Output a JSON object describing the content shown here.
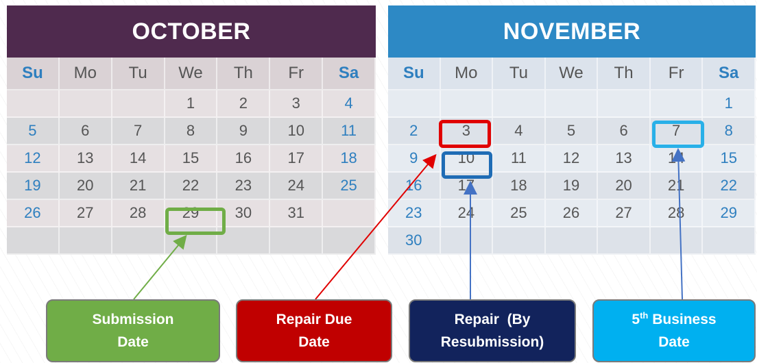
{
  "calendars": {
    "october": {
      "title": "OCTOBER",
      "days": [
        "Su",
        "Mo",
        "Tu",
        "We",
        "Th",
        "Fr",
        "Sa"
      ],
      "weeks": [
        [
          "",
          "",
          "",
          "1",
          "2",
          "3",
          "4"
        ],
        [
          "5",
          "6",
          "7",
          "8",
          "9",
          "10",
          "11"
        ],
        [
          "12",
          "13",
          "14",
          "15",
          "16",
          "17",
          "18"
        ],
        [
          "19",
          "20",
          "21",
          "22",
          "23",
          "24",
          "25"
        ],
        [
          "26",
          "27",
          "28",
          "29",
          "30",
          "31",
          ""
        ],
        [
          "",
          "",
          "",
          "",
          "",
          "",
          ""
        ]
      ]
    },
    "november": {
      "title": "NOVEMBER",
      "days": [
        "Su",
        "Mo",
        "Tu",
        "We",
        "Th",
        "Fr",
        "Sa"
      ],
      "weeks": [
        [
          "",
          "",
          "",
          "",
          "",
          "",
          "1"
        ],
        [
          "2",
          "3",
          "4",
          "5",
          "6",
          "7",
          "8"
        ],
        [
          "9",
          "10",
          "11",
          "12",
          "13",
          "14",
          "15"
        ],
        [
          "16",
          "17",
          "18",
          "19",
          "20",
          "21",
          "22"
        ],
        [
          "23",
          "24",
          "25",
          "26",
          "27",
          "28",
          "29"
        ],
        [
          "30",
          "",
          "",
          "",
          "",
          "",
          ""
        ]
      ]
    }
  },
  "callouts": {
    "submission": {
      "line1": "Submission",
      "line2": "Date",
      "color": "#70ad47"
    },
    "repair_due": {
      "line1": "Repair Due",
      "line2": "Date",
      "color": "#c00000"
    },
    "repair_resub": {
      "line1": "Repair  (By",
      "line2": "Resubmission)",
      "color": "#12235c"
    },
    "business": {
      "line1_num": "5",
      "line1_sup": "th",
      "line1_rest": " Business",
      "line2": "Date",
      "color": "#00b0f0"
    }
  },
  "highlights": {
    "submission_color": "#70ad47",
    "repair_due_color": "#e00000",
    "repair_resub_color": "#1f6cb5",
    "business_color": "#29b0e8"
  }
}
